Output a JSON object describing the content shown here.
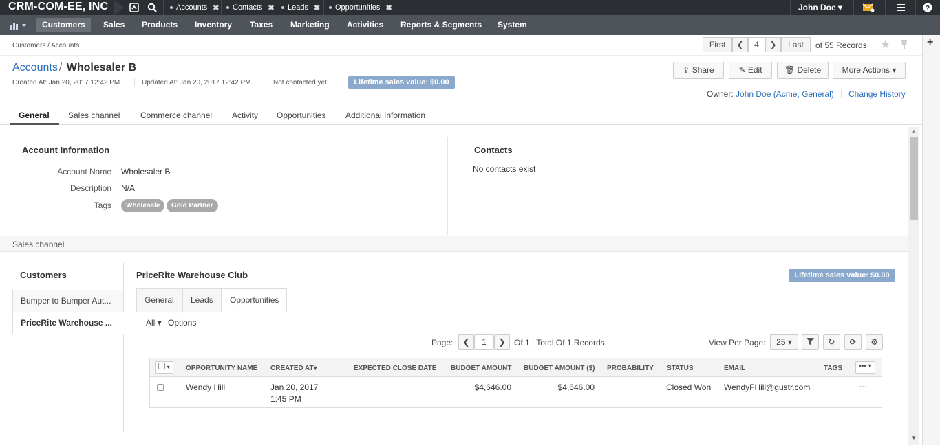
{
  "topbar": {
    "brand": "CRM-COM-EE, INC",
    "history": [
      "Accounts",
      "Contacts",
      "Leads",
      "Opportunities"
    ],
    "user": "John Doe"
  },
  "menu": [
    "Customers",
    "Sales",
    "Products",
    "Inventory",
    "Taxes",
    "Marketing",
    "Activities",
    "Reports & Segments",
    "System"
  ],
  "breadcrumb": "Customers / Accounts",
  "pager": {
    "first": "First",
    "page": "4",
    "last": "Last",
    "records": "of 55 Records"
  },
  "header": {
    "entity": "Accounts",
    "separator": "/",
    "name": "Wholesaler B",
    "created": "Created At: Jan 20, 2017 12:42 PM",
    "updated": "Updated At: Jan 20, 2017 12:42 PM",
    "contacted": "Not contacted yet",
    "lifetime": "Lifetime sales value: $0.00",
    "buttons": {
      "share": "Share",
      "edit": "Edit",
      "delete": "Delete",
      "more": "More Actions"
    },
    "owner_label": "Owner:",
    "owner": "John Doe",
    "owner_org": "(Acme, General)",
    "change_history": "Change History"
  },
  "tabs": [
    "General",
    "Sales channel",
    "Commerce channel",
    "Activity",
    "Opportunities",
    "Additional Information"
  ],
  "account_info": {
    "title": "Account Information",
    "name_label": "Account Name",
    "name": "Wholesaler B",
    "desc_label": "Description",
    "desc": "N/A",
    "tags_label": "Tags",
    "tags": [
      "Wholesale",
      "Gold Partner"
    ]
  },
  "contacts": {
    "title": "Contacts",
    "empty": "No contacts exist"
  },
  "sales_channel": {
    "band": "Sales channel",
    "customers_title": "Customers",
    "customers": [
      "Bumper to Bumper Aut...",
      "PriceRite Warehouse ..."
    ],
    "selected_title": "PriceRite Warehouse Club",
    "lifetime": "Lifetime sales value: $0.00",
    "subtabs": [
      "General",
      "Leads",
      "Opportunities"
    ],
    "filter_all": "All",
    "options": "Options",
    "page_label": "Page:",
    "page": "1",
    "of_records": "Of 1 | Total Of 1 Records",
    "view_per_page": "View Per Page:",
    "per_page": "25"
  },
  "grid": {
    "columns": [
      "Opportunity Name",
      "Created At",
      "Expected Close Date",
      "Budget Amount",
      "Budget Amount ($)",
      "Probability",
      "Status",
      "Email",
      "Tags"
    ],
    "rows": [
      {
        "name": "Wendy Hill",
        "created_date": "Jan 20, 2017",
        "created_time": "1:45 PM",
        "close": "",
        "budget": "$4,646.00",
        "budget_usd": "$4,646.00",
        "probability": "",
        "status": "Closed Won",
        "email": "WendyFHill@gustr.com",
        "tags": ""
      }
    ]
  }
}
